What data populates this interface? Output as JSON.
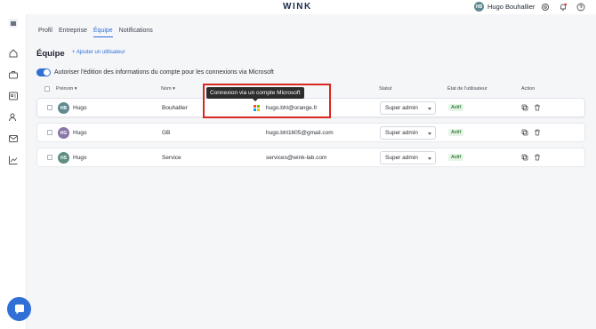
{
  "app": {
    "logo": "WINK"
  },
  "user": {
    "initials": "HB",
    "name": "Hugo Bouhallier"
  },
  "tabs": [
    {
      "label": "Profil",
      "active": false
    },
    {
      "label": "Entreprise",
      "active": false
    },
    {
      "label": "Équipe",
      "active": true
    },
    {
      "label": "Notifications",
      "active": false
    }
  ],
  "page": {
    "title": "Équipe",
    "add_user": "+ Ajouter un utilisateur",
    "toggle_label": "Autoriser l'édition des informations du compte pour les connexions via Microsoft",
    "toggle_on": true
  },
  "table": {
    "headers": {
      "prenom": "Prénom",
      "nom": "Nom",
      "statut": "Statut",
      "etat": "État de l'utilisateur",
      "action": "Action"
    },
    "rows": [
      {
        "initials": "HB",
        "avatar_color": "#5f8a8f",
        "prenom": "Hugo",
        "nom": "Bouhallier",
        "email": "hugo.bhl@orange.fr",
        "microsoft": true,
        "statut": "Super admin",
        "etat": "Actif"
      },
      {
        "initials": "HG",
        "avatar_color": "#8a76a8",
        "prenom": "Hugo",
        "nom": "GB",
        "email": "hugo.bhl1605@gmail.com",
        "microsoft": false,
        "statut": "Super admin",
        "etat": "Actif"
      },
      {
        "initials": "HS",
        "avatar_color": "#5f8f82",
        "prenom": "Hugo",
        "nom": "Service",
        "email": "services@wink-lab.com",
        "microsoft": false,
        "statut": "Super admin",
        "etat": "Actif"
      }
    ]
  },
  "tooltip": {
    "text": "Connexion via un compte Microsoft"
  },
  "colors": {
    "accent": "#2f6fd6",
    "highlight": "#d9271f",
    "active_badge": "#2e7d32"
  }
}
